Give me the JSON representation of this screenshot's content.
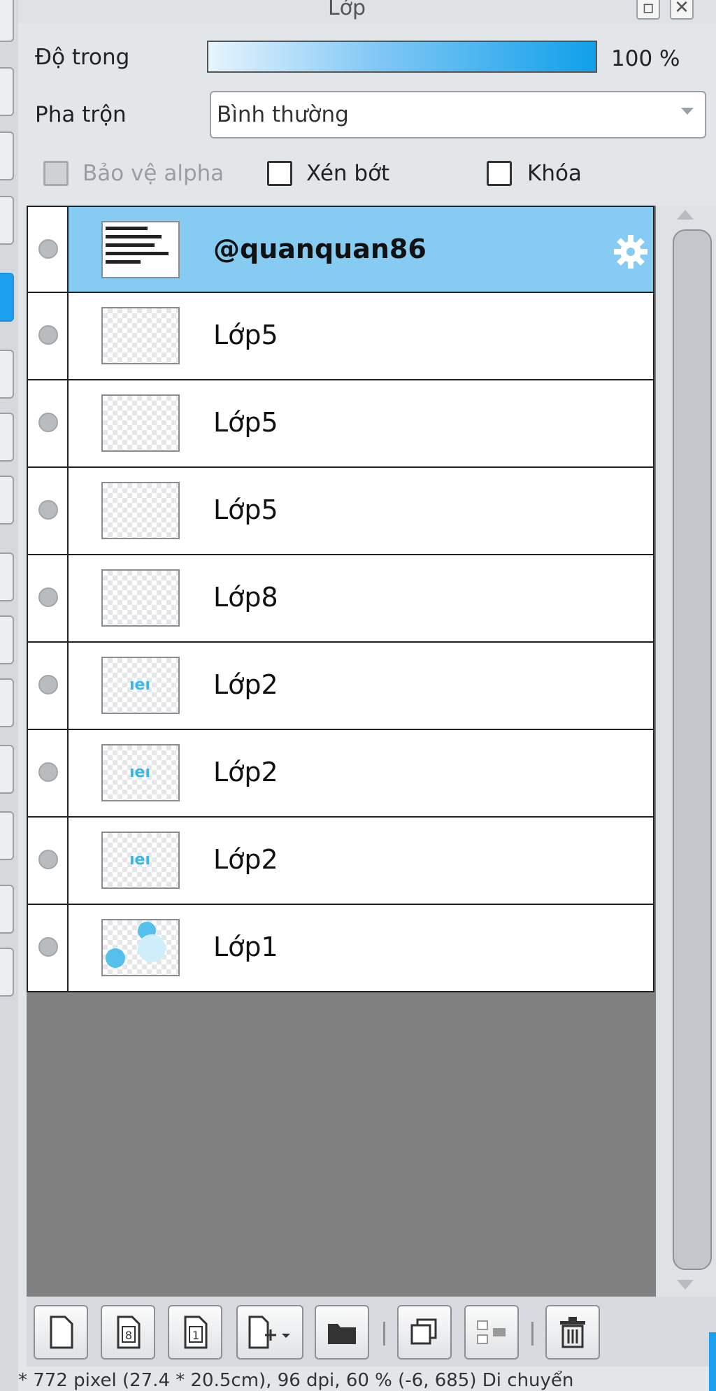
{
  "panel": {
    "title": "Lớp"
  },
  "opacity": {
    "label": "Độ trong",
    "value": "100 %",
    "level_percent": 100
  },
  "blend": {
    "label": "Pha trộn",
    "selected": "Bình thường"
  },
  "options": {
    "protect_alpha": {
      "label": "Bảo vệ alpha",
      "checked": false,
      "disabled": true
    },
    "clip": {
      "label": "Xén bớt",
      "checked": false
    },
    "lock": {
      "label": "Khóa",
      "checked": false
    }
  },
  "layers": [
    {
      "name": "@quanquan86",
      "selected": true,
      "thumb": "text",
      "icon": "gear-icon"
    },
    {
      "name": "Lớp5",
      "selected": false,
      "thumb": "sketch"
    },
    {
      "name": "Lớp5",
      "selected": false,
      "thumb": "sketch"
    },
    {
      "name": "Lớp5",
      "selected": false,
      "thumb": "sketch"
    },
    {
      "name": "Lớp8",
      "selected": false,
      "thumb": "empty"
    },
    {
      "name": "Lớp2",
      "selected": false,
      "thumb": "mark"
    },
    {
      "name": "Lớp2",
      "selected": false,
      "thumb": "mark"
    },
    {
      "name": "Lớp2",
      "selected": false,
      "thumb": "mark"
    },
    {
      "name": "Lớp1",
      "selected": false,
      "thumb": "circles"
    }
  ],
  "toolbar_icons": [
    "new-layer-icon",
    "new-8bit-layer-icon",
    "new-1bit-layer-icon",
    "add-layer-menu-icon",
    "folder-icon",
    "duplicate-layer-icon",
    "merge-layer-icon",
    "delete-layer-icon"
  ],
  "colors": {
    "selected_row": "#85cbf2",
    "accent": "#1ea0f0",
    "list_bg": "#808080"
  },
  "status": {
    "text": "* 772 pixel (27.4 * 20.5cm), 96 dpi, 60 % (-6, 685) Di chuyển"
  }
}
